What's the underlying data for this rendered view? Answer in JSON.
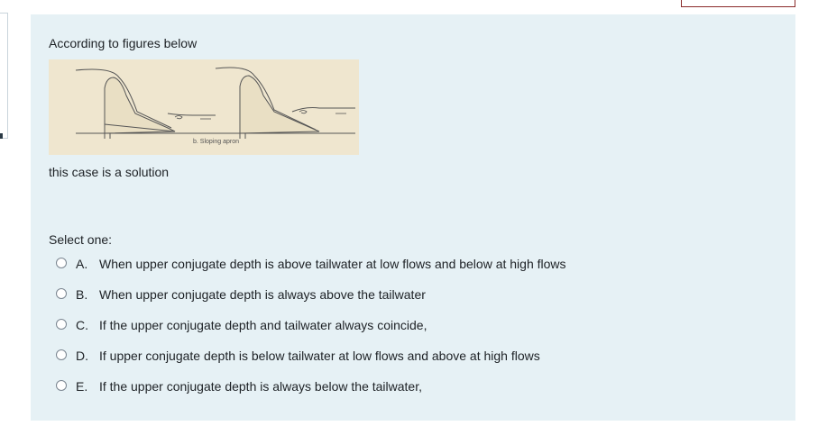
{
  "question": {
    "intro": "According to figures below",
    "figure_caption": "b. Sloping apron",
    "statement": "this case is a solution",
    "select_prompt": "Select one:"
  },
  "answers": [
    {
      "letter": "A.",
      "text": "When upper conjugate depth is above tailwater at low flows and below at high flows"
    },
    {
      "letter": "B.",
      "text": "When upper conjugate depth is always above the tailwater"
    },
    {
      "letter": "C.",
      "text": "If the upper conjugate depth and tailwater always coincide,"
    },
    {
      "letter": "D.",
      "text": "If upper conjugate depth is below tailwater at low flows and above at high flows"
    },
    {
      "letter": "E.",
      "text": "If the upper conjugate depth is always below the tailwater,"
    }
  ]
}
